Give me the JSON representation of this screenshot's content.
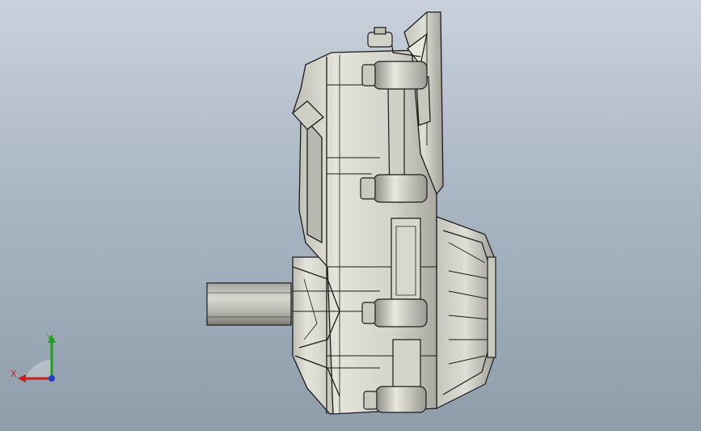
{
  "viewport": {
    "background_top": "#c9d2dc",
    "background_bottom": "#8f9dab"
  },
  "model": {
    "body_color": "#d6d6cc",
    "edge_color": "#1c1c1c",
    "shading_color": "#8e8e86"
  },
  "triad": {
    "x_label": "X",
    "y_label": "Y",
    "x_color": "#c81e1e",
    "y_color": "#1ea01e",
    "z_color": "#1e3cc8"
  }
}
